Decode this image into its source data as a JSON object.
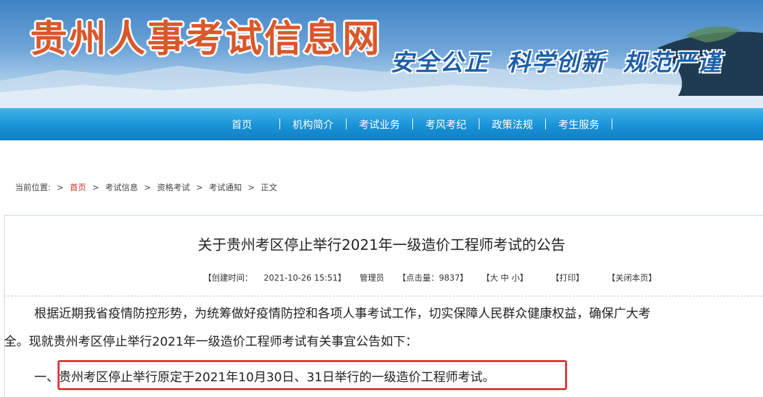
{
  "banner": {
    "site_title": "贵州人事考试信息网",
    "motto_1": "安全公正",
    "motto_2": "科学创新",
    "motto_3": "规范严谨"
  },
  "nav": {
    "items": [
      "首页",
      "机构简介",
      "考试业务",
      "考风考纪",
      "政策法规",
      "考生服务"
    ]
  },
  "breadcrumb": {
    "label": "当前位置:",
    "items": [
      "首页",
      "考试信息",
      "资格考试",
      "考试通知",
      "正文"
    ]
  },
  "article": {
    "title": "关于贵州考区停止举行2021年一级造价工程师考试的公告",
    "created_label": "【创建时间：",
    "created_value": "2021-10-26 15:51】",
    "author": "管理员",
    "views": "【点击量：9837】",
    "font_size": "【大 中 小】",
    "print": "【打印】",
    "close": "【关闭本页】",
    "para1": "根据近期我省疫情防控形势，为统筹做好疫情防控和各项人事考试工作，切实保障人民群众健康权益，确保广大考",
    "para2": "全。现就贵州考区停止举行2021年一级造价工程师考试有关事宜公告如下：",
    "para3": "一、贵州考区停止举行原定于2021年10月30日、31日举行的一级造价工程师考试。"
  },
  "colors": {
    "nav_bg": "#1a93d6",
    "title_orange": "#d9582b",
    "highlight_red": "#e0393c"
  }
}
